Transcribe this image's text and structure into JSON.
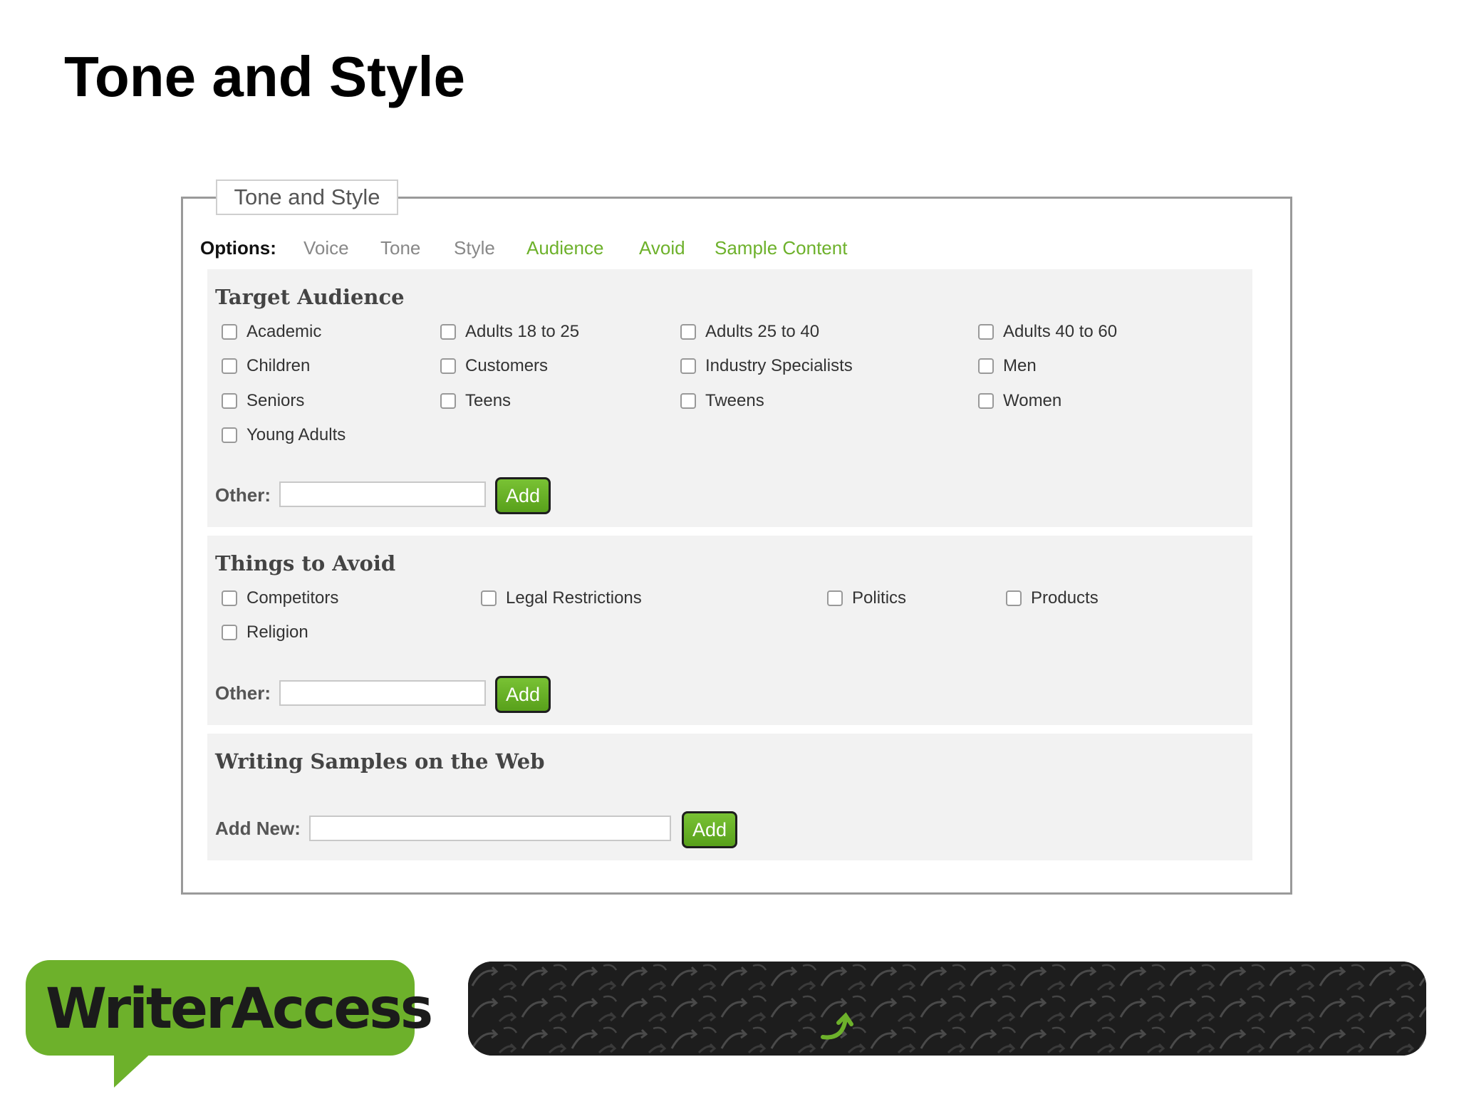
{
  "slide": {
    "title": "Tone and Style"
  },
  "panel": {
    "legend": "Tone and Style"
  },
  "options": {
    "label": "Options:",
    "items": [
      "Voice",
      "Tone",
      "Style",
      "Audience",
      "Avoid",
      "Sample Content"
    ]
  },
  "target_audience": {
    "title": "Target Audience",
    "checkboxes": [
      "Academic",
      "Adults 18 to 25",
      "Adults 25 to 40",
      "Adults 40 to 60",
      "Children",
      "Customers",
      "Industry Specialists",
      "Men",
      "Seniors",
      "Teens",
      "Tweens",
      "Women",
      "Young Adults"
    ],
    "other_label": "Other:",
    "add_label": "Add"
  },
  "avoid": {
    "title": "Things to Avoid",
    "checkboxes": [
      "Competitors",
      "Legal Restrictions",
      "Politics",
      "Products",
      "Religion"
    ],
    "other_label": "Other:",
    "add_label": "Add"
  },
  "samples": {
    "title": "Writing Samples on the Web",
    "add_new_label": "Add New:",
    "add_label": "Add"
  },
  "footer": {
    "logo_text": "WriterAccess"
  },
  "colors": {
    "accent_green": "#6db12b",
    "option_gray": "#888888",
    "dark": "#1d1d1d"
  }
}
